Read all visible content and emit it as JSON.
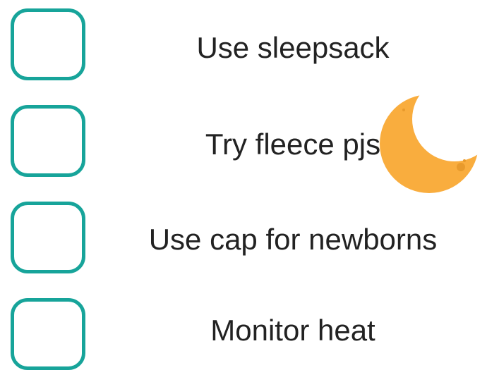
{
  "checklist": {
    "items": [
      {
        "label": "Use sleepsack",
        "checked": false
      },
      {
        "label": "Try fleece pjs",
        "checked": false
      },
      {
        "label": "Use cap for newborns",
        "checked": false
      },
      {
        "label": "Monitor heat",
        "checked": false
      }
    ]
  },
  "decoration": {
    "icon": "crescent-moon-icon"
  },
  "colors": {
    "checkbox_border": "#17a49a",
    "text": "#222222",
    "moon": "#f9ad3e",
    "moon_crater": "#e89a2c"
  }
}
